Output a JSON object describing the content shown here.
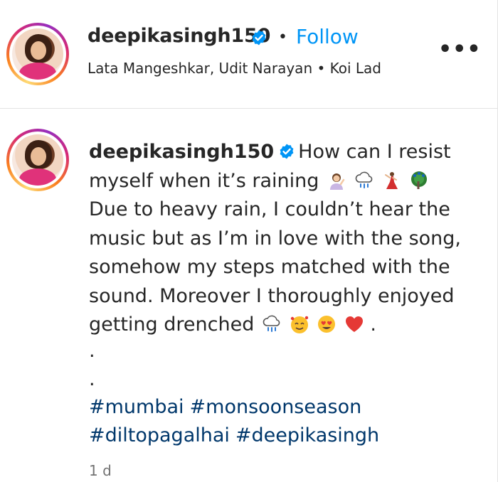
{
  "header": {
    "username": "deepikasingh150",
    "separator": "•",
    "follow_label": "Follow",
    "more_label": "•••",
    "audio": "Lata Mangeshkar, Udit Narayan • Koi Lad",
    "verified_icon": "verified-badge-icon"
  },
  "post": {
    "username": "deepikasingh150",
    "caption_line1": "How can I resist",
    "caption_line2": "myself when it’s raining",
    "caption_line3": "Due to heavy rain, I couldn’t hear the",
    "caption_line4": "music but as I’m in love with the song,",
    "caption_line5": "somehow my steps matched with the",
    "caption_line6": "sound. Moreover I thoroughly enjoyed",
    "caption_line7": "getting drenched",
    "caption_line7_end": ".",
    "dot1": ".",
    "dot2": ".",
    "hashtags": [
      "#mumbai",
      "#monsoonseason",
      "#diltopagalhai",
      "#deepikasingh"
    ],
    "timestamp": "1 d",
    "emojis_line2": [
      "woman-gesturing-icon",
      "rain-cloud-icon",
      "dancer-icon",
      "peacock-icon"
    ],
    "emojis_line7": [
      "rain-cloud-icon",
      "smiling-hearts-icon",
      "heart-eyes-icon",
      "red-heart-icon"
    ]
  },
  "colors": {
    "follow": "#0095f6",
    "hashtag": "#00376b",
    "verified": "#0095f6",
    "muted": "#737373"
  }
}
